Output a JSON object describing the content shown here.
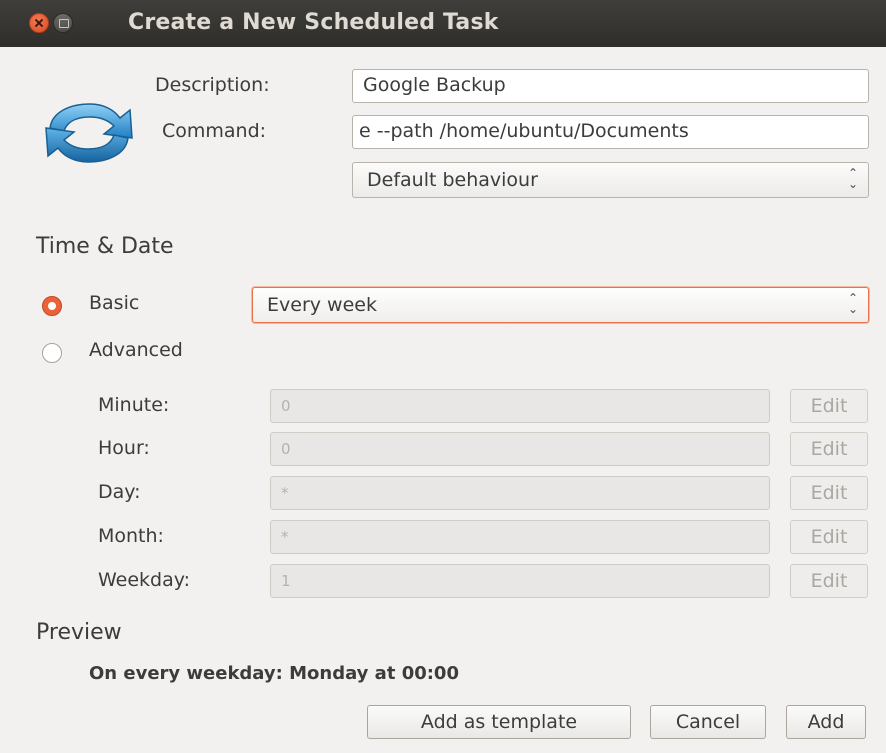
{
  "window": {
    "title": "Create a New Scheduled Task"
  },
  "icons": {
    "close": "close-icon",
    "minimize": "minimize-icon",
    "app": "refresh-sync-icon",
    "spinner": "up-down-arrows-icon"
  },
  "colors": {
    "accent": "#e9623a",
    "titlebar": "#3b3a36",
    "background": "#f2f1f0"
  },
  "form": {
    "description_label": "Description:",
    "description_value": "Google Backup",
    "command_label": "Command:",
    "command_value": "e --path /home/ubuntu/Documents",
    "behaviour_value": "Default behaviour"
  },
  "time_date": {
    "heading": "Time & Date",
    "basic_label": "Basic",
    "basic_selected": true,
    "basic_value": "Every week",
    "advanced_label": "Advanced",
    "fields": [
      {
        "label": "Minute:",
        "value": "0",
        "edit_label": "Edit"
      },
      {
        "label": "Hour:",
        "value": "0",
        "edit_label": "Edit"
      },
      {
        "label": "Day:",
        "value": "*",
        "edit_label": "Edit"
      },
      {
        "label": "Month:",
        "value": "*",
        "edit_label": "Edit"
      },
      {
        "label": "Weekday:",
        "value": "1",
        "edit_label": "Edit"
      }
    ]
  },
  "preview": {
    "heading": "Preview",
    "text": "On every weekday: Monday at 00:00"
  },
  "buttons": {
    "add_template": "Add as template",
    "cancel": "Cancel",
    "add": "Add"
  }
}
